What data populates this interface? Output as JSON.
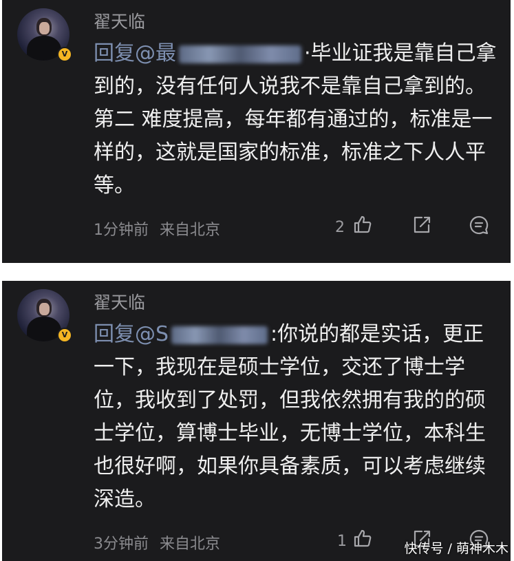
{
  "comments": [
    {
      "username": "翟天临",
      "reply_prefix": "回复@",
      "reply_visible_char": "最",
      "body": "·毕业证我是靠自己拿到的，没有任何人说我不是靠自己拿到的。第二 难度提高，每年都有通过的，标准是一样的，这就是国家的标准，标准之下人人平等。",
      "time": "1分钟前",
      "location": "来自北京",
      "like_count": "2",
      "verified_badge": "V"
    },
    {
      "username": "翟天临",
      "reply_prefix": "回复@",
      "reply_visible_char": "S",
      "body": ":你说的都是实话，更正一下，我现在是硕士学位，交还了博士学位，我收到了处罚，但我依然拥有我的的硕士学位，算博士毕业，无博士学位，本科生也很好啊，如果你具备素质，可以考虑继续深造。",
      "time": "3分钟前",
      "location": "来自北京",
      "like_count": "1",
      "verified_badge": "V"
    }
  ],
  "watermark": "快传号 / 萌神木木",
  "icons": [
    "thumbs-up-icon",
    "share-icon",
    "comment-icon"
  ]
}
